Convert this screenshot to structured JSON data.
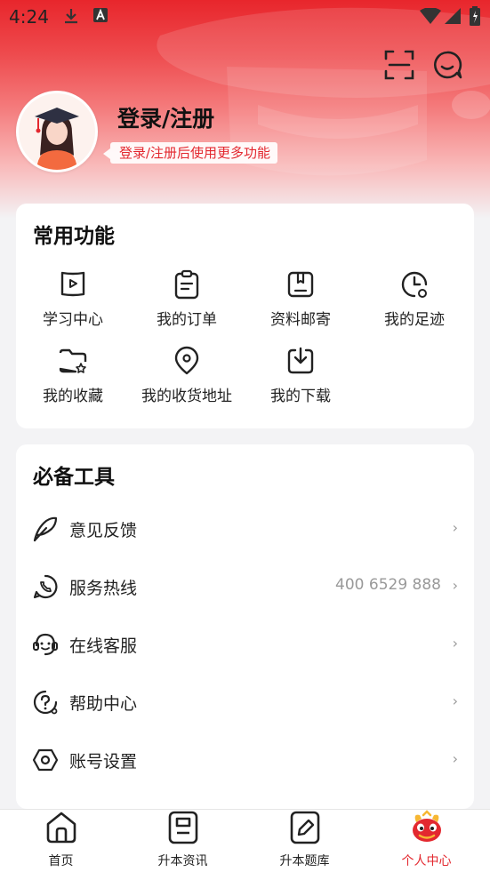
{
  "status_bar": {
    "time": "4:24",
    "icons": [
      "download-icon",
      "a-notification-icon",
      "wifi-icon",
      "signal-icon",
      "battery-icon"
    ]
  },
  "header": {
    "icons": [
      "scan-icon",
      "message-icon"
    ]
  },
  "profile": {
    "title": "登录/注册",
    "subtitle": "登录/注册后使用更多功能"
  },
  "common_functions": {
    "title": "常用功能",
    "items": [
      {
        "label": "学习中心",
        "icon": "video-book-icon"
      },
      {
        "label": "我的订单",
        "icon": "clipboard-icon"
      },
      {
        "label": "资料邮寄",
        "icon": "mail-box-icon"
      },
      {
        "label": "我的足迹",
        "icon": "history-clock-icon"
      },
      {
        "label": "我的收藏",
        "icon": "star-folder-icon"
      },
      {
        "label": "我的收货地址",
        "icon": "location-pin-icon"
      },
      {
        "label": "我的下载",
        "icon": "download-box-icon"
      }
    ]
  },
  "tools": {
    "title": "必备工具",
    "items": [
      {
        "label": "意见反馈",
        "value": "",
        "icon": "feather-icon"
      },
      {
        "label": "服务热线",
        "value": "400 6529 888",
        "icon": "phone-icon"
      },
      {
        "label": "在线客服",
        "value": "",
        "icon": "service-face-icon"
      },
      {
        "label": "帮助中心",
        "value": "",
        "icon": "help-icon"
      },
      {
        "label": "账号设置",
        "value": "",
        "icon": "hexagon-settings-icon"
      }
    ],
    "chevron": "›"
  },
  "bottom_nav": {
    "items": [
      {
        "label": "首页",
        "icon": "home-icon",
        "active": false
      },
      {
        "label": "升本资讯",
        "icon": "news-icon",
        "active": false
      },
      {
        "label": "升本题库",
        "icon": "edit-icon",
        "active": false
      },
      {
        "label": "个人中心",
        "icon": "mascot-icon",
        "active": true
      }
    ]
  },
  "colors": {
    "accent": "#e3282f",
    "background": "#f3f3f5",
    "card": "#ffffff",
    "muted_text": "#999999"
  }
}
